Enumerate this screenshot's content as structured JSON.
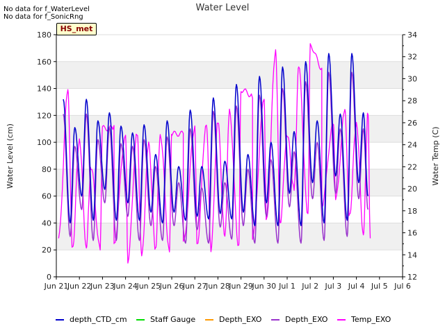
{
  "notes": [
    "No data for f_WaterLevel",
    "No data for f_SonicRng"
  ],
  "station_badge": "HS_met",
  "colors": {
    "depth_CTD_cm": "#0000cc",
    "Staff Gauge": "#00dd00",
    "Depth_EXO_orange": "#ff9900",
    "Depth_EXO": "#9933cc",
    "Temp_EXO": "#ff00ff"
  },
  "chart_data": {
    "type": "line",
    "title": "Water Level",
    "ylabel": "Water Level (cm)",
    "y2label": "Water Temp (C)",
    "ylim": [
      0,
      180
    ],
    "y2lim": [
      12,
      34
    ],
    "xlim": [
      "Jun 21",
      "Jul 6"
    ],
    "x_ticks": [
      "Jun 21",
      "Jun 22",
      "Jun 23",
      "Jun 24",
      "Jun 25",
      "Jun 26",
      "Jun 27",
      "Jun 28",
      "Jun 29",
      "Jun 30",
      "Jul 1",
      "Jul 2",
      "Jul 3",
      "Jul 4",
      "Jul 5",
      "Jul 6"
    ],
    "y_ticks": [
      0,
      20,
      40,
      60,
      80,
      100,
      120,
      140,
      160,
      180
    ],
    "y2_ticks": [
      12,
      14,
      16,
      18,
      20,
      22,
      24,
      26,
      28,
      30,
      32,
      34
    ],
    "grid": "horizontal bands",
    "legend_position": "bottom",
    "series": [
      {
        "name": "depth_CTD_cm",
        "axis": "left",
        "daily_peaks": [
          [
            21.3,
            132
          ],
          [
            21.8,
            111
          ],
          [
            22.3,
            132
          ],
          [
            22.8,
            116
          ],
          [
            23.3,
            122
          ],
          [
            23.8,
            112
          ],
          [
            24.3,
            107
          ],
          [
            24.8,
            113
          ],
          [
            25.3,
            91
          ],
          [
            25.8,
            116
          ],
          [
            26.3,
            82
          ],
          [
            26.8,
            124
          ],
          [
            27.3,
            82
          ],
          [
            27.8,
            133
          ],
          [
            28.3,
            86
          ],
          [
            28.8,
            143
          ],
          [
            29.3,
            91
          ],
          [
            29.8,
            149
          ],
          [
            30.3,
            100
          ],
          [
            30.8,
            156
          ],
          [
            31.3,
            108
          ],
          [
            31.8,
            160
          ],
          [
            32.3,
            116
          ],
          [
            32.8,
            166
          ],
          [
            33.3,
            121
          ],
          [
            33.8,
            166
          ],
          [
            34.3,
            122
          ]
        ],
        "daily_troughs": [
          [
            21.6,
            40
          ],
          [
            22.1,
            60
          ],
          [
            22.6,
            42
          ],
          [
            23.1,
            65
          ],
          [
            23.6,
            42
          ],
          [
            24.1,
            55
          ],
          [
            24.6,
            42
          ],
          [
            25.1,
            48
          ],
          [
            25.6,
            40
          ],
          [
            26.1,
            48
          ],
          [
            26.6,
            42
          ],
          [
            27.1,
            45
          ],
          [
            27.6,
            43
          ],
          [
            28.1,
            47
          ],
          [
            28.6,
            43
          ],
          [
            29.1,
            48
          ],
          [
            29.6,
            38
          ],
          [
            30.1,
            55
          ],
          [
            30.6,
            38
          ],
          [
            31.1,
            62
          ],
          [
            31.6,
            38
          ],
          [
            32.1,
            70
          ],
          [
            32.6,
            40
          ],
          [
            33.1,
            75
          ],
          [
            33.6,
            42
          ],
          [
            34.1,
            70
          ],
          [
            34.5,
            60
          ]
        ]
      },
      {
        "name": "Staff Gauge",
        "axis": "left",
        "points": []
      },
      {
        "name": "Depth_EXO",
        "axis": "left",
        "points": []
      },
      {
        "name": "Depth_EXO",
        "axis": "left",
        "daily_peaks": [
          [
            21.3,
            121
          ],
          [
            21.8,
            97
          ],
          [
            22.3,
            121
          ],
          [
            22.8,
            102
          ],
          [
            23.3,
            111
          ],
          [
            23.8,
            99
          ],
          [
            24.3,
            97
          ],
          [
            24.8,
            102
          ],
          [
            25.3,
            82
          ],
          [
            25.8,
            104
          ],
          [
            26.3,
            70
          ],
          [
            26.8,
            110
          ],
          [
            27.3,
            66
          ],
          [
            27.8,
            123
          ],
          [
            28.3,
            70
          ],
          [
            28.8,
            127
          ],
          [
            29.3,
            80
          ],
          [
            29.8,
            135
          ],
          [
            30.3,
            87
          ],
          [
            30.8,
            140
          ],
          [
            31.3,
            93
          ],
          [
            31.8,
            145
          ],
          [
            32.3,
            100
          ],
          [
            32.8,
            152
          ],
          [
            33.3,
            110
          ],
          [
            33.8,
            152
          ],
          [
            34.3,
            110
          ]
        ],
        "daily_troughs": [
          [
            21.6,
            30
          ],
          [
            22.1,
            50
          ],
          [
            22.6,
            27
          ],
          [
            23.1,
            55
          ],
          [
            23.6,
            27
          ],
          [
            24.1,
            45
          ],
          [
            24.6,
            27
          ],
          [
            25.1,
            38
          ],
          [
            25.6,
            27
          ],
          [
            26.1,
            38
          ],
          [
            26.6,
            25
          ],
          [
            27.1,
            35
          ],
          [
            27.6,
            25
          ],
          [
            28.1,
            37
          ],
          [
            28.6,
            28
          ],
          [
            29.1,
            38
          ],
          [
            29.6,
            25
          ],
          [
            30.1,
            45
          ],
          [
            30.6,
            25
          ],
          [
            31.1,
            52
          ],
          [
            31.6,
            25
          ],
          [
            32.1,
            58
          ],
          [
            32.6,
            27
          ],
          [
            33.1,
            62
          ],
          [
            33.6,
            30
          ],
          [
            34.1,
            58
          ],
          [
            34.5,
            50
          ]
        ]
      },
      {
        "name": "Temp_EXO",
        "axis": "right",
        "daily_peaks": [
          [
            21.5,
            28.8
          ],
          [
            22.0,
            24.5
          ],
          [
            22.5,
            22.0
          ],
          [
            23.0,
            25.5
          ],
          [
            23.5,
            25.5
          ],
          [
            24.0,
            25.0
          ],
          [
            24.5,
            25.0
          ],
          [
            25.0,
            24.0
          ],
          [
            25.5,
            25.0
          ],
          [
            26.0,
            25.0
          ],
          [
            26.5,
            25.0
          ],
          [
            27.0,
            25.5
          ],
          [
            27.5,
            26.0
          ],
          [
            28.0,
            26.0
          ],
          [
            28.5,
            27.0
          ],
          [
            29.0,
            29.0
          ],
          [
            29.5,
            28.5
          ],
          [
            30.0,
            28.0
          ],
          [
            30.5,
            32.5
          ],
          [
            31.0,
            25.0
          ],
          [
            31.5,
            31.0
          ],
          [
            32.0,
            33.0
          ],
          [
            32.5,
            31.0
          ],
          [
            33.0,
            26.0
          ],
          [
            33.5,
            27.0
          ],
          [
            34.0,
            26.0
          ],
          [
            34.5,
            27.0
          ]
        ],
        "daily_troughs": [
          [
            21.1,
            15.5
          ],
          [
            21.7,
            14.5
          ],
          [
            22.3,
            14.8
          ],
          [
            22.9,
            14.5
          ],
          [
            23.5,
            15.0
          ],
          [
            24.1,
            13.5
          ],
          [
            24.7,
            13.8
          ],
          [
            25.3,
            14.5
          ],
          [
            25.9,
            14.5
          ],
          [
            26.5,
            15.0
          ],
          [
            27.1,
            15.0
          ],
          [
            27.7,
            14.5
          ],
          [
            28.3,
            15.5
          ],
          [
            28.9,
            14.8
          ],
          [
            29.5,
            15.5
          ],
          [
            30.1,
            17.0
          ],
          [
            30.7,
            17.0
          ],
          [
            31.3,
            20.0
          ],
          [
            31.9,
            17.5
          ],
          [
            32.5,
            18.5
          ],
          [
            33.1,
            19.0
          ],
          [
            33.7,
            17.5
          ],
          [
            34.3,
            16.0
          ],
          [
            34.6,
            15.5
          ]
        ]
      }
    ]
  }
}
